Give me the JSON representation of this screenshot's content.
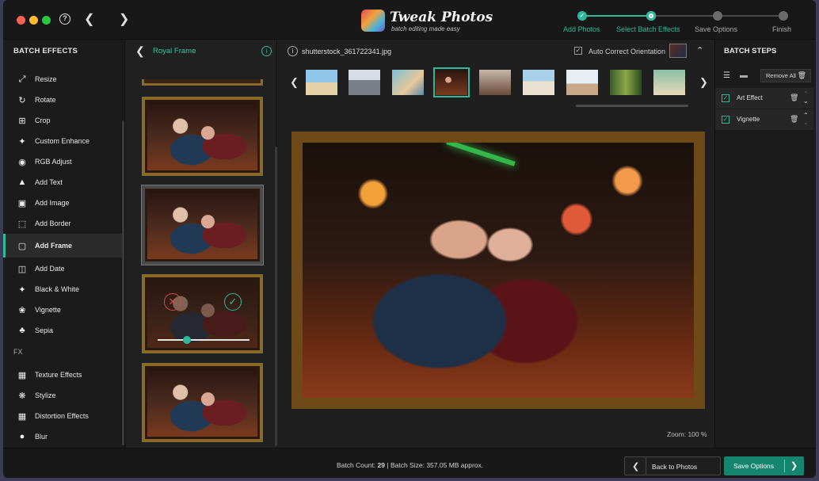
{
  "header": {
    "logo_title": "Tweak Photos",
    "logo_subtitle": "batch editing made easy",
    "steps": [
      {
        "label": "Add Photos",
        "state": "done"
      },
      {
        "label": "Select Batch Effects",
        "state": "current"
      },
      {
        "label": "Save Options",
        "state": "pending"
      },
      {
        "label": "Finish",
        "state": "pending"
      }
    ]
  },
  "sidebar": {
    "title": "BATCH EFFECTS",
    "items": [
      {
        "label": "Resize",
        "icon": "resize-icon"
      },
      {
        "label": "Rotate",
        "icon": "rotate-icon"
      },
      {
        "label": "Crop",
        "icon": "crop-icon"
      },
      {
        "label": "Custom Enhance",
        "icon": "enhance-icon"
      },
      {
        "label": "RGB Adjust",
        "icon": "rgb-icon"
      },
      {
        "label": "Add Text",
        "icon": "text-icon"
      },
      {
        "label": "Add Image",
        "icon": "image-icon"
      },
      {
        "label": "Add Border",
        "icon": "border-icon"
      },
      {
        "label": "Add Frame",
        "icon": "frame-icon"
      },
      {
        "label": "Add Date",
        "icon": "date-icon"
      },
      {
        "label": "Black & White",
        "icon": "bw-icon"
      },
      {
        "label": "Vignette",
        "icon": "vignette-icon"
      },
      {
        "label": "Sepia",
        "icon": "sepia-icon"
      }
    ],
    "active_item": "Add Frame",
    "fx_label": "FX",
    "fx_items": [
      {
        "label": "Texture Effects",
        "icon": "texture-icon"
      },
      {
        "label": "Stylize",
        "icon": "stylize-icon"
      },
      {
        "label": "Distortion Effects",
        "icon": "distortion-icon"
      },
      {
        "label": "Blur",
        "icon": "blur-icon"
      }
    ]
  },
  "frame_panel": {
    "title": "Royal Frame"
  },
  "center": {
    "file_name": "shutterstock_361722341.jpg",
    "auto_correct_label": "Auto Correct Orientation",
    "auto_correct_checked": true,
    "zoom_label": "Zoom: 100 %"
  },
  "right_panel": {
    "title": "BATCH STEPS",
    "remove_all_label": "Remove  All",
    "steps": [
      {
        "label": "Art Effect",
        "checked": true
      },
      {
        "label": "Vignette",
        "checked": true
      }
    ]
  },
  "footer": {
    "batch_count_label": "Batch Count:",
    "batch_count": "29",
    "separator": "|",
    "batch_size_label": "Batch Size:",
    "batch_size": "357.05 MB approx.",
    "back_button": "Back to Photos",
    "save_button": "Save Options"
  },
  "colors": {
    "accent": "#2fb89a",
    "save_button": "#16856d",
    "frame_gold": "#8a6a2a"
  }
}
